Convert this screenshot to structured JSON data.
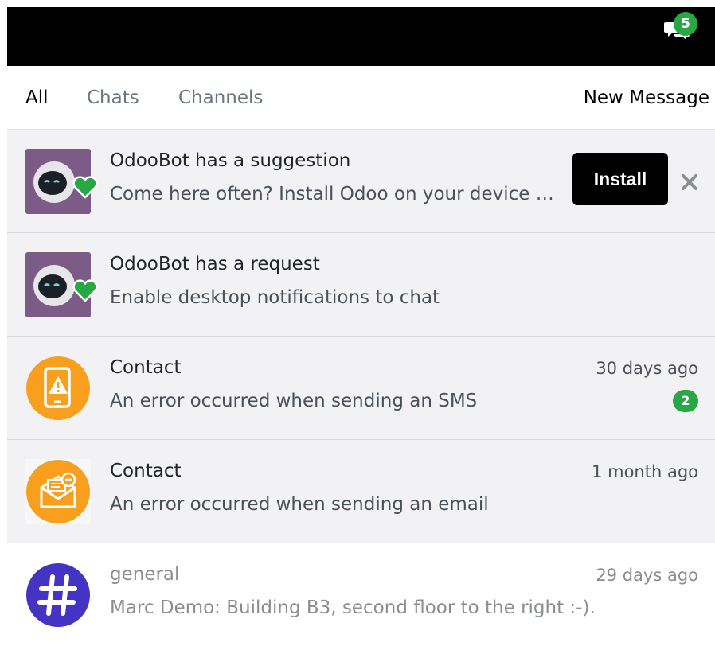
{
  "header": {
    "chat_icon": "chat-bubbles-icon",
    "unread_counter": "5"
  },
  "filters": {
    "all": "All",
    "chats": "Chats",
    "channels": "Channels",
    "new_message": "New Message"
  },
  "previews": [
    {
      "avatar": "odoobot-avatar",
      "status": "online-heart-icon",
      "title": "OdooBot has a suggestion",
      "body": "Come here often? Install Odoo on your device to check your messages",
      "install_label": "Install",
      "dismiss_icon": "close-icon"
    },
    {
      "avatar": "odoobot-avatar",
      "status": "online-heart-icon",
      "title": "OdooBot has a request",
      "body": "Enable desktop notifications to chat"
    },
    {
      "avatar": "sms-failure-icon",
      "title": "Contact",
      "body": "An error occurred when sending an SMS",
      "date": "30 days ago",
      "counter": "2"
    },
    {
      "avatar": "email-failure-icon",
      "title": "Contact",
      "body": "An error occurred when sending an email",
      "date": "1 month ago"
    },
    {
      "avatar": "channel-hash-icon",
      "title": "general",
      "body": "Marc Demo: Building B3, second floor to the right :-).",
      "date": "29 days ago"
    }
  ],
  "colors": {
    "accent_green": "#28a745",
    "failure_orange": "#f8a01e",
    "channel_purple": "#4534c4",
    "odoobot_purple": "#7c5c86"
  }
}
